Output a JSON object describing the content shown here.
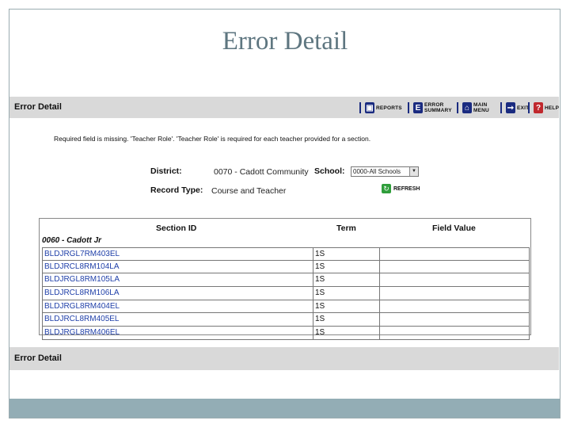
{
  "slide": {
    "title": "Error Detail"
  },
  "app": {
    "header_title": "Error Detail",
    "footer_title": "Error Detail",
    "nav": [
      {
        "name": "reports",
        "icon": "reports-icon",
        "label_line1": "REPORTS",
        "label_line2": "",
        "color": "#1a2b80"
      },
      {
        "name": "error-summary",
        "icon": "error-summary-icon",
        "label_line1": "ERROR",
        "label_line2": "SUMMARY",
        "color": "#1a2b80"
      },
      {
        "name": "main-menu",
        "icon": "home-icon",
        "label_line1": "MAIN",
        "label_line2": "MENU",
        "color": "#1a2b80"
      },
      {
        "name": "exit",
        "icon": "exit-icon",
        "label_line1": "EXIT",
        "label_line2": "",
        "color": "#1a2b80"
      },
      {
        "name": "help",
        "icon": "help-icon",
        "label_line1": "HELP",
        "label_line2": "",
        "color": "#c0282d"
      }
    ],
    "message": "Required field is missing. 'Teacher Role'. 'Teacher Role' is required for each teacher provided for a section.",
    "district_label": "District:",
    "district_value": "0070 - Cadott Community",
    "school_label": "School:",
    "school_selected": "0000-All Schools",
    "record_type_label": "Record Type:",
    "record_type_value": "Course and Teacher",
    "refresh_label": "REFRESH",
    "table": {
      "headers": [
        "Section ID",
        "Term",
        "Field Value"
      ],
      "school_group": "0060 - Cadott Jr",
      "rows": [
        {
          "section_id": "BLDJRGL7RM403EL",
          "term": "1S",
          "field_value": ""
        },
        {
          "section_id": "BLDJRCL8RM104LA",
          "term": "1S",
          "field_value": ""
        },
        {
          "section_id": "BLDJRGL8RM105LA",
          "term": "1S",
          "field_value": ""
        },
        {
          "section_id": "BLDJRCL8RM106LA",
          "term": "1S",
          "field_value": ""
        },
        {
          "section_id": "BLDJRGL8RM404EL",
          "term": "1S",
          "field_value": ""
        },
        {
          "section_id": "BLDJRCL8RM405EL",
          "term": "1S",
          "field_value": ""
        },
        {
          "section_id": "BLDJRGL8RM406EL",
          "term": "1S",
          "field_value": ""
        }
      ]
    }
  }
}
